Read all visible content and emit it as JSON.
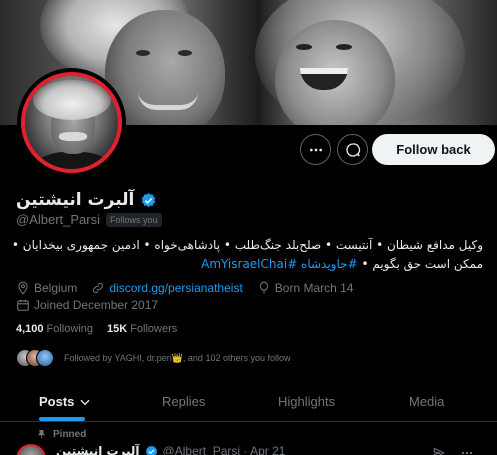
{
  "profile": {
    "name": "آلبرت انیشتین",
    "handle": "@Albert_Parsi",
    "follows_you": "Follows you",
    "bio_line1": "وکیل مدافع شیطان • آنتیست • صلح‌بلد جنگ‌طلب • پادشاهی‌خواه • ادمین جمهوری بیخدایان •",
    "bio_line2_text": "ممکن است حق بگویم • ",
    "bio_hashtags": "#جاویدشاه #AmYisraelChai",
    "location": "Belgium",
    "website": "discord.gg/persianatheist",
    "birthday": "Born March 14",
    "joined": "Joined December 2017",
    "following_count": "4,100",
    "following_label": "Following",
    "followers_count": "15K",
    "followers_label": "Followers",
    "followed_by": "Followed by YAGHI, dr.peri👑, and 102 others you follow"
  },
  "actions": {
    "follow_back": "Follow back"
  },
  "tabs": [
    {
      "label": "Posts",
      "active": true
    },
    {
      "label": "Replies",
      "active": false
    },
    {
      "label": "Highlights",
      "active": false
    },
    {
      "label": "Media",
      "active": false
    }
  ],
  "pinned_post": {
    "pinned_label": "Pinned",
    "author_name": "آلبرت انیشتین",
    "author_handle": "@Albert_Parsi · Apr 21"
  },
  "colors": {
    "accent": "#1d9bf0",
    "avatar_ring": "#e0212f",
    "background": "#000000",
    "muted_text": "#71767b"
  },
  "icons": [
    "more-icon",
    "grok-icon",
    "verified-badge-icon",
    "location-icon",
    "link-icon",
    "balloon-icon",
    "calendar-icon",
    "chevron-down-icon",
    "pin-icon",
    "share-icon"
  ]
}
